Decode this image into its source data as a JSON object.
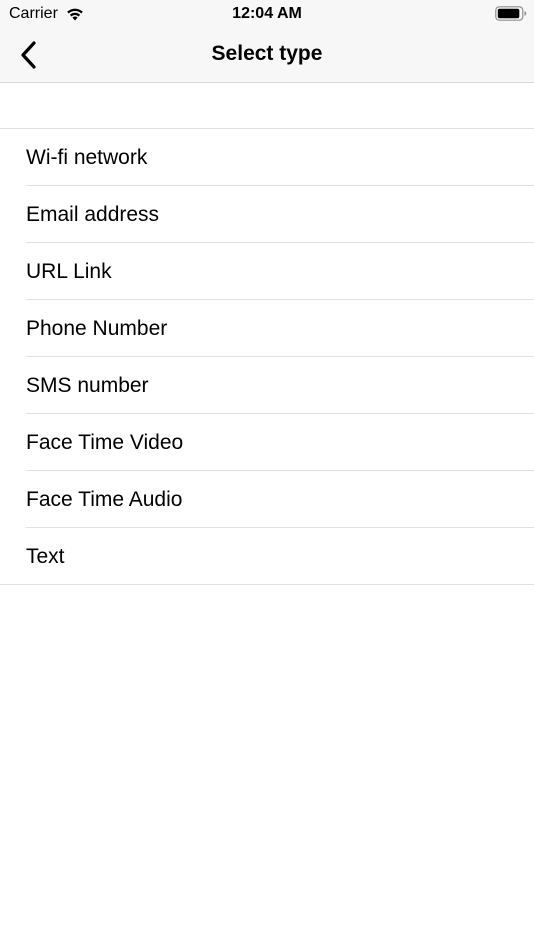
{
  "status_bar": {
    "carrier": "Carrier",
    "time": "12:04 AM",
    "wifi_icon": "wifi-icon",
    "battery_icon": "battery-icon"
  },
  "nav": {
    "title": "Select type",
    "back_icon": "chevron-left-icon"
  },
  "types": [
    {
      "label": "Wi-fi network"
    },
    {
      "label": "Email address"
    },
    {
      "label": "URL Link"
    },
    {
      "label": "Phone Number"
    },
    {
      "label": "SMS number"
    },
    {
      "label": "Face Time Video"
    },
    {
      "label": "Face Time Audio"
    },
    {
      "label": "Text"
    }
  ],
  "colors": {
    "nav_background": "#f7f7f7",
    "separator": "#e2e2e2",
    "text": "#000000"
  }
}
